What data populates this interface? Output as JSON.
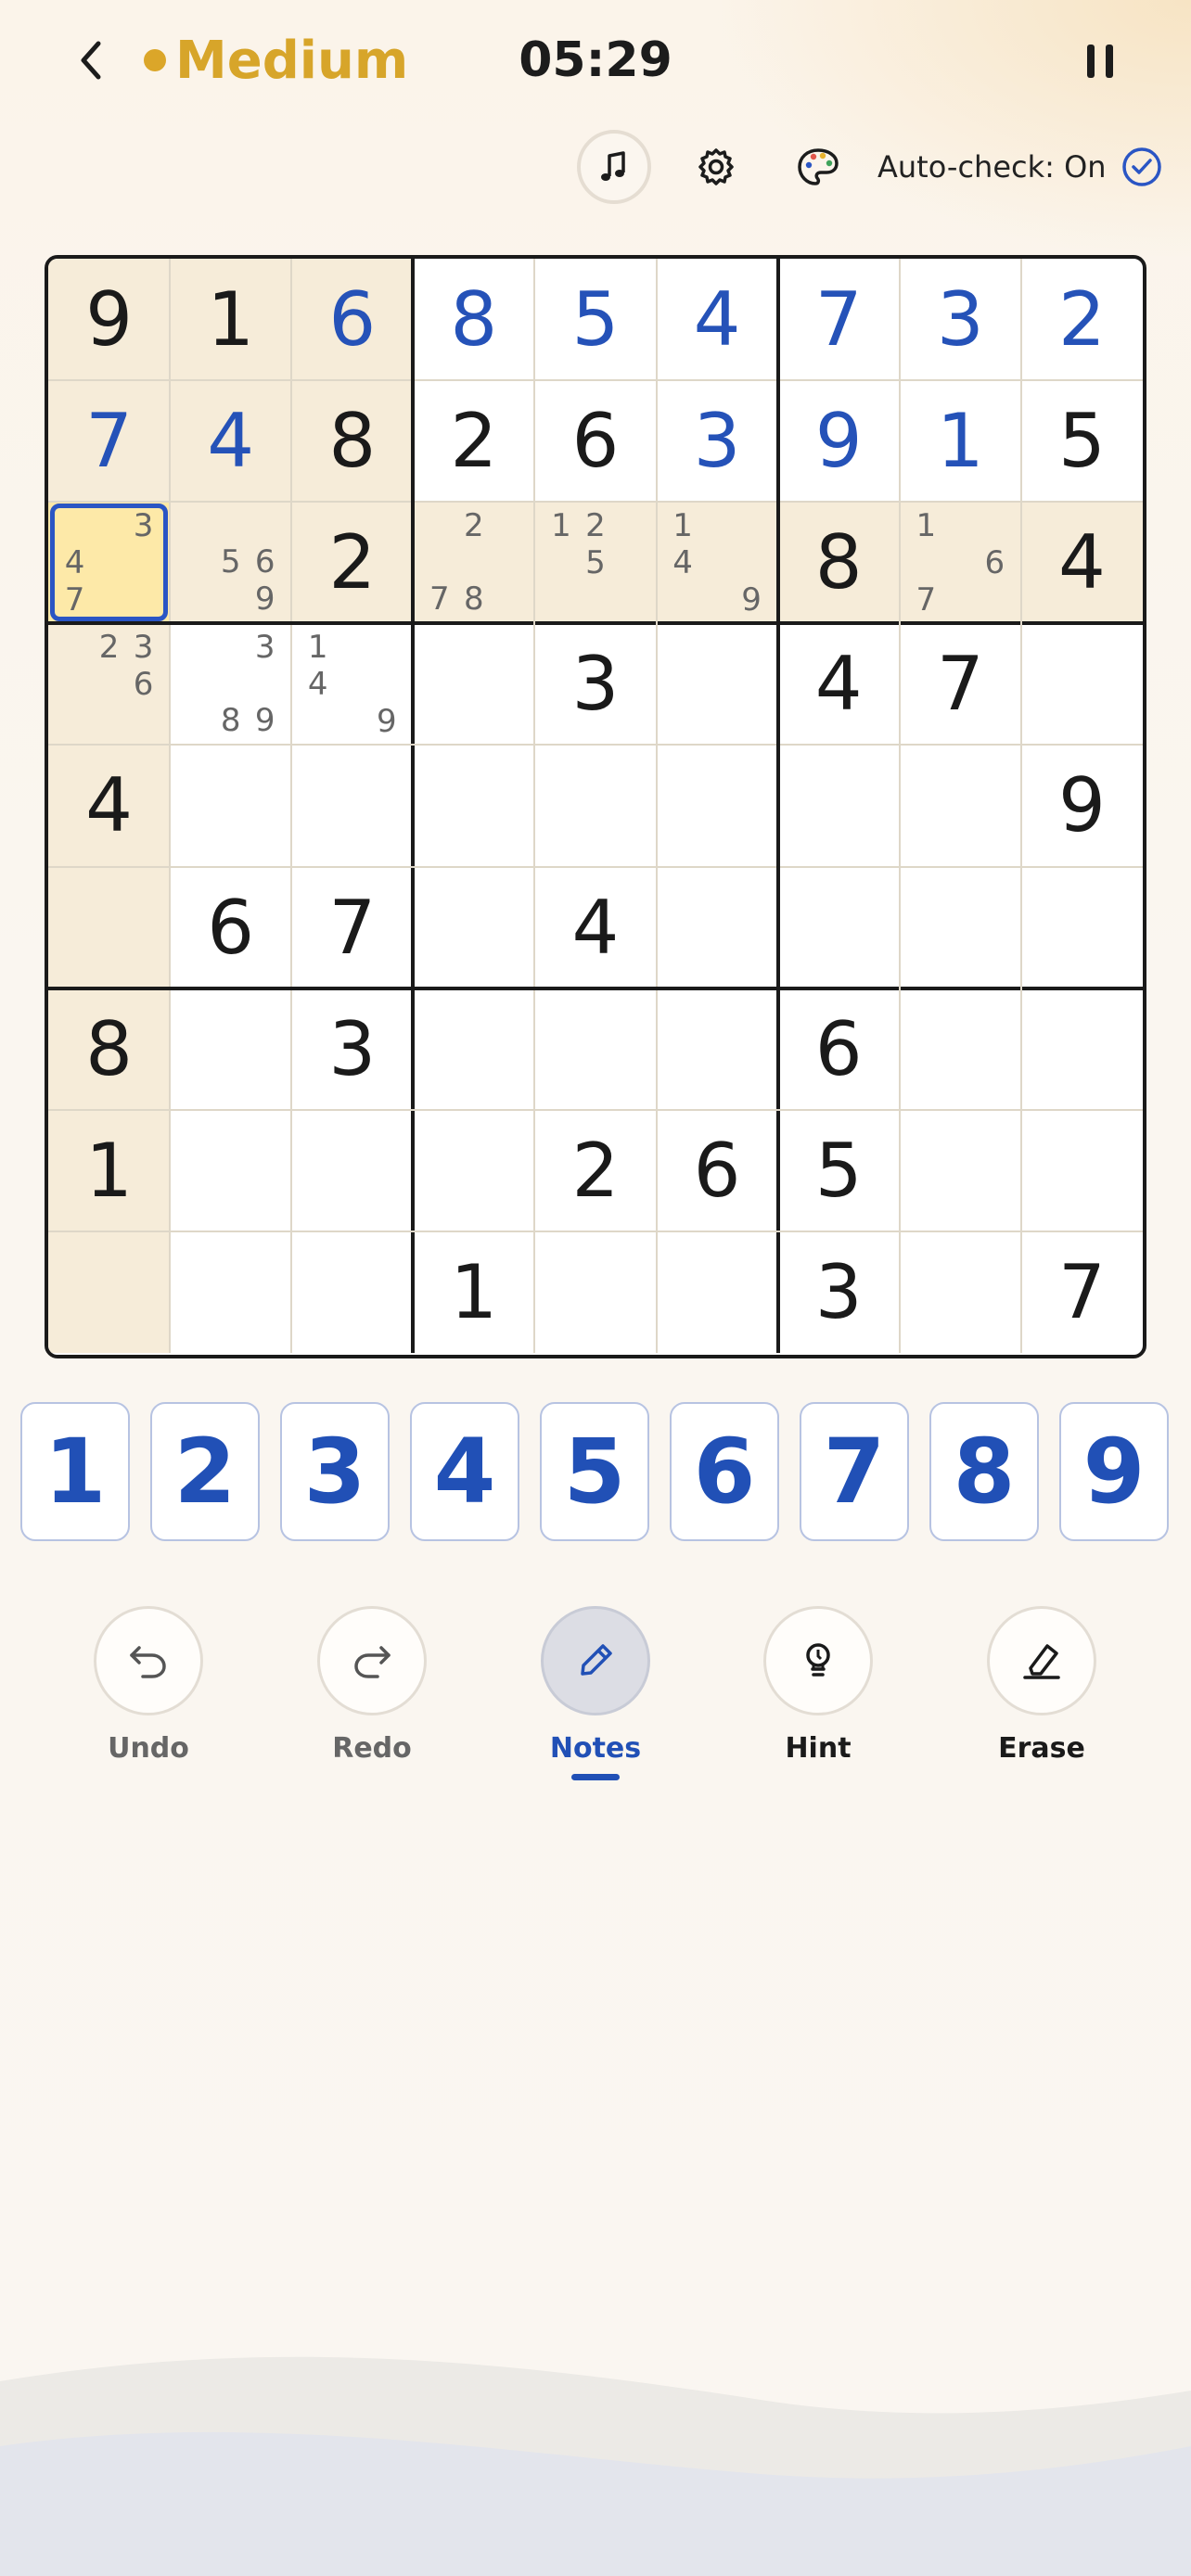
{
  "header": {
    "difficulty": "Medium",
    "timer": "05:29"
  },
  "toolbar": {
    "autocheck_label": "Auto-check: On"
  },
  "board": {
    "selected": [
      2,
      0
    ],
    "highlight_row": 2,
    "highlight_col": 0,
    "highlight_box": [
      0,
      0
    ],
    "cells": [
      [
        {
          "v": "9",
          "t": "g"
        },
        {
          "v": "1",
          "t": "g"
        },
        {
          "v": "6",
          "t": "u"
        },
        {
          "v": "8",
          "t": "u"
        },
        {
          "v": "5",
          "t": "u"
        },
        {
          "v": "4",
          "t": "u"
        },
        {
          "v": "7",
          "t": "u"
        },
        {
          "v": "3",
          "t": "u"
        },
        {
          "v": "2",
          "t": "u"
        }
      ],
      [
        {
          "v": "7",
          "t": "u"
        },
        {
          "v": "4",
          "t": "u"
        },
        {
          "v": "8",
          "t": "g"
        },
        {
          "v": "2",
          "t": "g"
        },
        {
          "v": "6",
          "t": "g"
        },
        {
          "v": "3",
          "t": "u"
        },
        {
          "v": "9",
          "t": "u"
        },
        {
          "v": "1",
          "t": "u"
        },
        {
          "v": "5",
          "t": "g"
        }
      ],
      [
        {
          "n": [
            3,
            4,
            7
          ]
        },
        {
          "n": [
            5,
            6,
            9
          ]
        },
        {
          "v": "2",
          "t": "g"
        },
        {
          "n": [
            2,
            7,
            8
          ]
        },
        {
          "n": [
            1,
            2,
            5
          ]
        },
        {
          "n": [
            1,
            4,
            9
          ]
        },
        {
          "v": "8",
          "t": "g"
        },
        {
          "n": [
            1,
            6,
            7
          ]
        },
        {
          "v": "4",
          "t": "g"
        }
      ],
      [
        {
          "n": [
            2,
            3,
            6
          ]
        },
        {
          "n": [
            3,
            8,
            9
          ]
        },
        {
          "n": [
            1,
            4,
            9
          ]
        },
        {},
        {
          "v": "3",
          "t": "g"
        },
        {},
        {
          "v": "4",
          "t": "g"
        },
        {
          "v": "7",
          "t": "g"
        },
        {}
      ],
      [
        {
          "v": "4",
          "t": "g"
        },
        {},
        {},
        {},
        {},
        {},
        {},
        {},
        {
          "v": "9",
          "t": "g"
        }
      ],
      [
        {},
        {
          "v": "6",
          "t": "g"
        },
        {
          "v": "7",
          "t": "g"
        },
        {},
        {
          "v": "4",
          "t": "g"
        },
        {},
        {},
        {},
        {}
      ],
      [
        {
          "v": "8",
          "t": "g"
        },
        {},
        {
          "v": "3",
          "t": "g"
        },
        {},
        {},
        {},
        {
          "v": "6",
          "t": "g"
        },
        {},
        {}
      ],
      [
        {
          "v": "1",
          "t": "g"
        },
        {},
        {},
        {},
        {
          "v": "2",
          "t": "g"
        },
        {
          "v": "6",
          "t": "g"
        },
        {
          "v": "5",
          "t": "g"
        },
        {},
        {}
      ],
      [
        {},
        {},
        {},
        {
          "v": "1",
          "t": "g"
        },
        {},
        {},
        {
          "v": "3",
          "t": "g"
        },
        {},
        {
          "v": "7",
          "t": "g"
        }
      ]
    ]
  },
  "numpad": [
    "1",
    "2",
    "3",
    "4",
    "5",
    "6",
    "7",
    "8",
    "9"
  ],
  "actions": [
    {
      "id": "undo",
      "label": "Undo",
      "icon": "undo-icon"
    },
    {
      "id": "redo",
      "label": "Redo",
      "icon": "redo-icon"
    },
    {
      "id": "notes",
      "label": "Notes",
      "icon": "pencil-icon",
      "active": true
    },
    {
      "id": "hint",
      "label": "Hint",
      "icon": "lightbulb-icon"
    },
    {
      "id": "erase",
      "label": "Erase",
      "icon": "eraser-icon"
    }
  ],
  "colors": {
    "accent": "#2150b6",
    "difficulty": "#d7a52a",
    "highlight": "#f6ecd9",
    "selected_fill": "#fde9a8",
    "selected_border": "#2a55c4"
  }
}
